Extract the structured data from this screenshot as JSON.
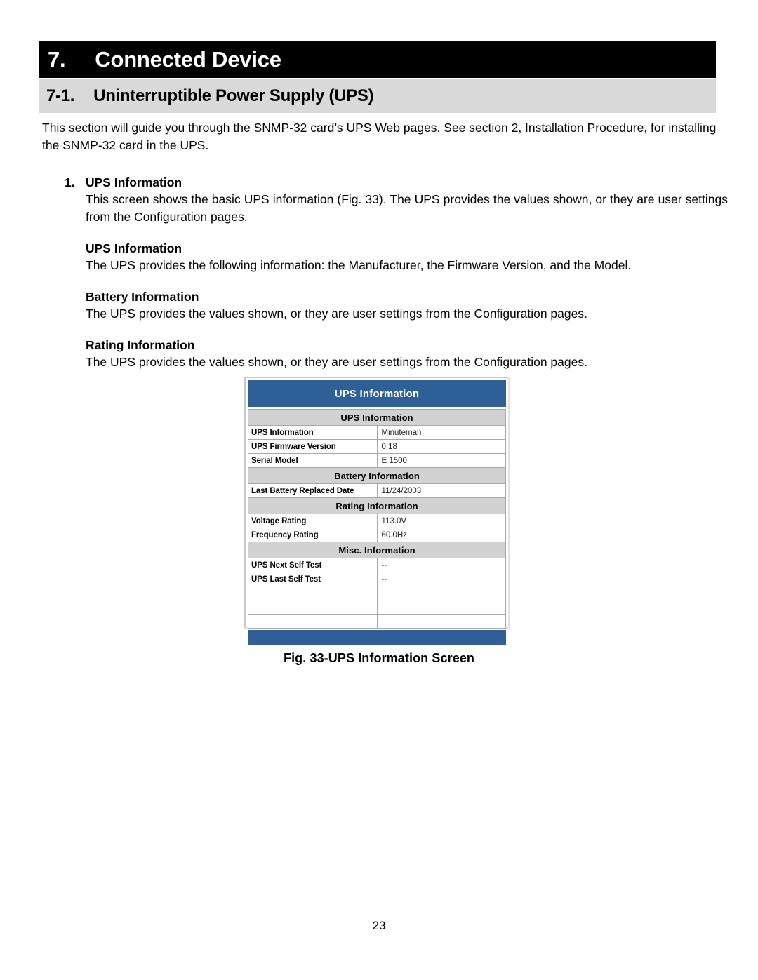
{
  "chapter": {
    "number": "7.",
    "title": "Connected Device"
  },
  "section": {
    "number": "7-1.",
    "title": "Uninterruptible Power Supply (UPS)"
  },
  "intro": "This section will guide you through the SNMP-32 card’s UPS Web pages.  See section 2, Installation Procedure, for installing the SNMP-32 card in the UPS.",
  "item": {
    "number": "1.",
    "heading": "UPS Information",
    "paragraph": "This screen shows the basic UPS information (Fig. 33).  The UPS provides the values shown, or they are user settings from the Configuration pages.",
    "subsections": [
      {
        "heading": "UPS Information",
        "text": "The UPS provides the following information:  the Manufacturer, the Firmware Version, and the Model."
      },
      {
        "heading": "Battery Information",
        "text": "The UPS provides the values shown, or they are user settings from the Configuration pages."
      },
      {
        "heading": "Rating Information",
        "text": "The UPS provides the values shown, or they are user settings from the Configuration pages."
      }
    ]
  },
  "screenshot": {
    "title": "UPS Information",
    "header_color": "#2f5f97",
    "section_row_color": "#d2d2d2",
    "sections": [
      {
        "header": "UPS Information",
        "rows": [
          {
            "label": "UPS Information",
            "value": "Minuteman"
          },
          {
            "label": "UPS Firmware Version",
            "value": "0.18"
          },
          {
            "label": "Serial Model",
            "value": "E 1500"
          }
        ]
      },
      {
        "header": "Battery Information",
        "rows": [
          {
            "label": "Last Battery Replaced Date",
            "value": "11/24/2003"
          }
        ]
      },
      {
        "header": "Rating Information",
        "rows": [
          {
            "label": "Voltage Rating",
            "value": "113.0V"
          },
          {
            "label": "Frequency Rating",
            "value": "60.0Hz"
          }
        ]
      },
      {
        "header": "Misc. Information",
        "rows": [
          {
            "label": "UPS Next Self Test",
            "value": "--"
          },
          {
            "label": "UPS Last Self Test",
            "value": "--"
          },
          {
            "label": "",
            "value": ""
          },
          {
            "label": "",
            "value": ""
          },
          {
            "label": "",
            "value": ""
          }
        ]
      }
    ]
  },
  "figure_caption": "Fig. 33-UPS Information Screen",
  "page_number": "23"
}
